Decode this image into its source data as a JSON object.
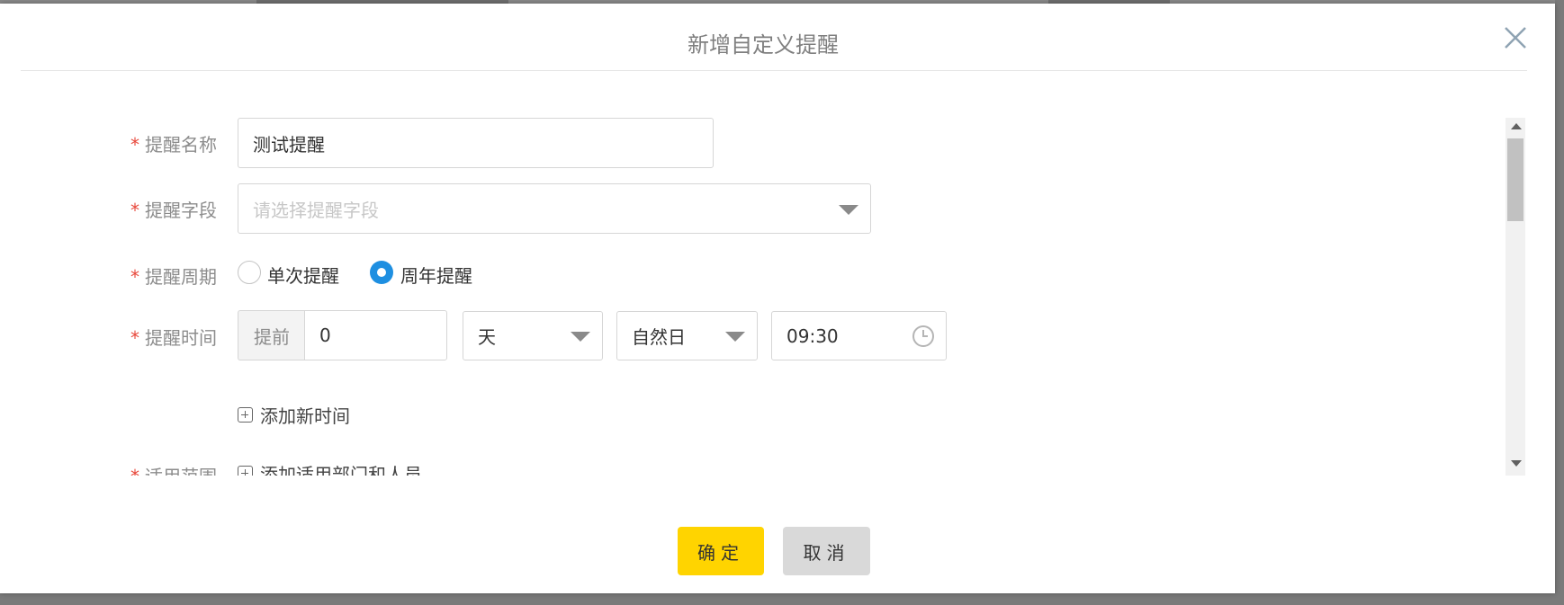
{
  "dialog": {
    "title": "新增自定义提醒",
    "close_icon": "close-icon"
  },
  "form": {
    "name": {
      "required_mark": "*",
      "label": "提醒名称",
      "value": "测试提醒"
    },
    "field": {
      "required_mark": "*",
      "label": "提醒字段",
      "placeholder": "请选择提醒字段"
    },
    "cycle": {
      "required_mark": "*",
      "label": "提醒周期",
      "options": [
        "单次提醒",
        "周年提醒"
      ],
      "selected": "周年提醒"
    },
    "time": {
      "required_mark": "*",
      "label": "提醒时间",
      "prefix": "提前",
      "amount": "0",
      "unit": "天",
      "day_type": "自然日",
      "clock": "09:30",
      "add_time_label": "添加新时间"
    },
    "scope": {
      "required_mark": "*",
      "label": "适用范围",
      "add_label": "添加适用部门和人员"
    }
  },
  "footer": {
    "ok_label": "确定",
    "cancel_label": "取消"
  },
  "colors": {
    "primary_button": "#ffd400",
    "radio_checked": "#1e8fe1",
    "required": "#e8483b"
  }
}
